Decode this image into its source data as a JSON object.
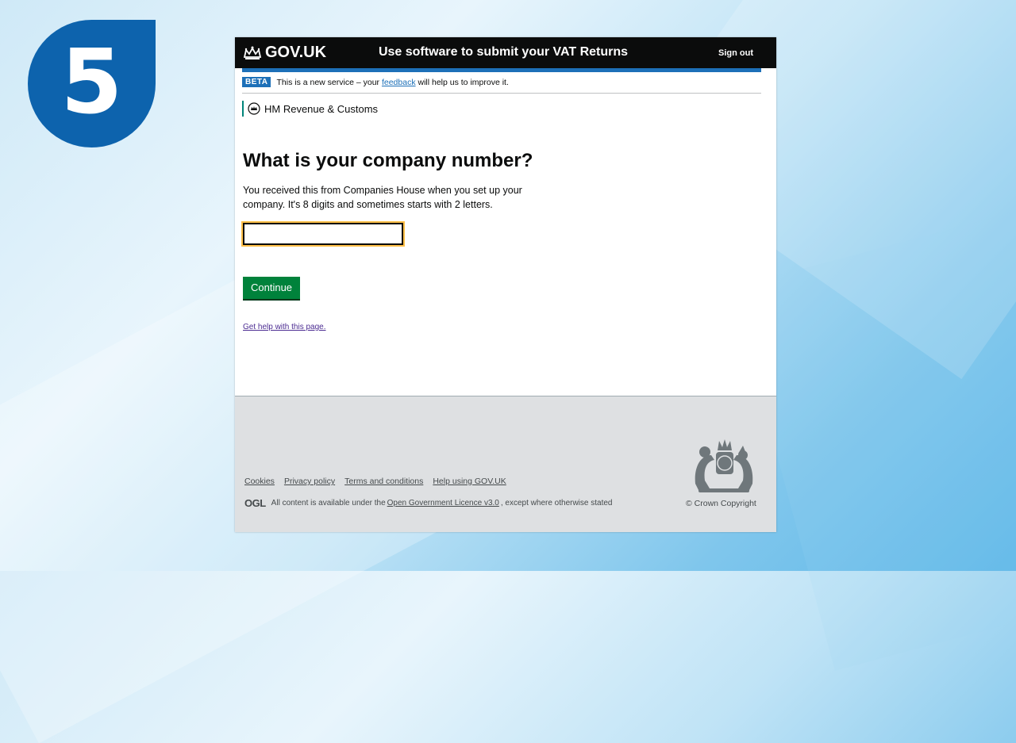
{
  "step": {
    "number": "5",
    "color": "#0d63ad"
  },
  "header": {
    "logo_text": "GOV.UK",
    "service_name": "Use software to submit your VAT Returns",
    "sign_out": "Sign out"
  },
  "phase_banner": {
    "tag": "BETA",
    "text_before": "This is a new service – your ",
    "link": "feedback",
    "text_after": " will help us to improve it."
  },
  "organisation": {
    "name": "HM Revenue & Customs",
    "icon": "hmrc-crest-icon"
  },
  "main": {
    "title": "What is your company number?",
    "hint": "You received this from Companies House when you set up your company. It's 8 digits and sometimes starts with 2 letters.",
    "input_value": "",
    "continue_label": "Continue",
    "help_link": "Get help with this page."
  },
  "footer": {
    "links": [
      "Cookies",
      "Privacy policy",
      "Terms and conditions",
      "Help using GOV.UK"
    ],
    "ogl": "OGL",
    "licence_before": "All content is available under the",
    "licence_link": "Open Government Licence v3.0",
    "licence_after": ", except where otherwise stated",
    "copyright": "© Crown Copyright"
  },
  "colors": {
    "header_bg": "#0b0c0c",
    "link_blue": "#1d70b8",
    "button_green": "#00823b",
    "focus_yellow": "#ffbf47",
    "footer_bg": "#dee0e2"
  }
}
